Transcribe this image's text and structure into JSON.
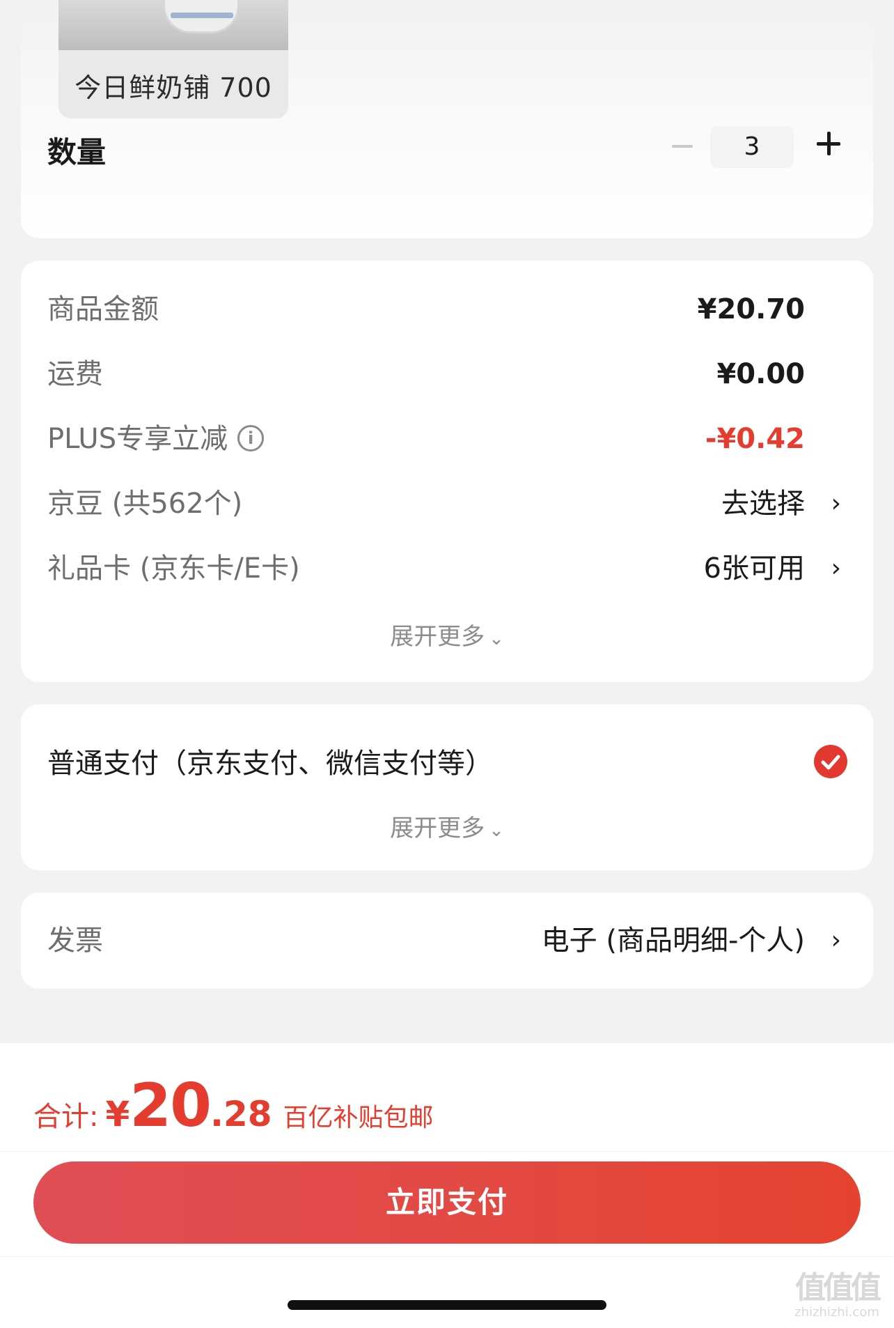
{
  "product": {
    "thumb_caption": "今日鲜奶铺 700",
    "quantity_label": "数量",
    "quantity_value": "3"
  },
  "prices": {
    "goods_amount_label": "商品金额",
    "goods_amount_value": "¥20.70",
    "shipping_label": "运费",
    "shipping_value": "¥0.00",
    "plus_discount_label": "PLUS专享立减",
    "plus_discount_value": "-¥0.42",
    "jingdou_label": "京豆 (共562个)",
    "jingdou_value": "去选择",
    "giftcard_label": "礼品卡 (京东卡/E卡)",
    "giftcard_value": "6张可用",
    "expand_more": "展开更多"
  },
  "payment": {
    "method_label": "普通支付（京东支付、微信支付等）",
    "expand_more": "展开更多"
  },
  "invoice": {
    "label": "发票",
    "value": "电子 (商品明细-个人)"
  },
  "footer": {
    "total_label": "合计:",
    "currency": "¥",
    "total_integer": "20",
    "total_decimal": ".28",
    "total_note": "百亿补贴包邮",
    "pay_button": "立即支付"
  },
  "watermark": {
    "big": "值值值",
    "small": "zhizhizhi.com"
  },
  "colors": {
    "accent_red": "#e43d2f",
    "background": "#f2f2f2",
    "card": "#ffffff"
  },
  "icons": {
    "info": "info-icon",
    "chevron_right": "chevron-right-icon",
    "chevron_down": "chevron-down-icon",
    "check": "check-circle-icon",
    "minus": "minus-icon",
    "plus": "plus-icon"
  }
}
